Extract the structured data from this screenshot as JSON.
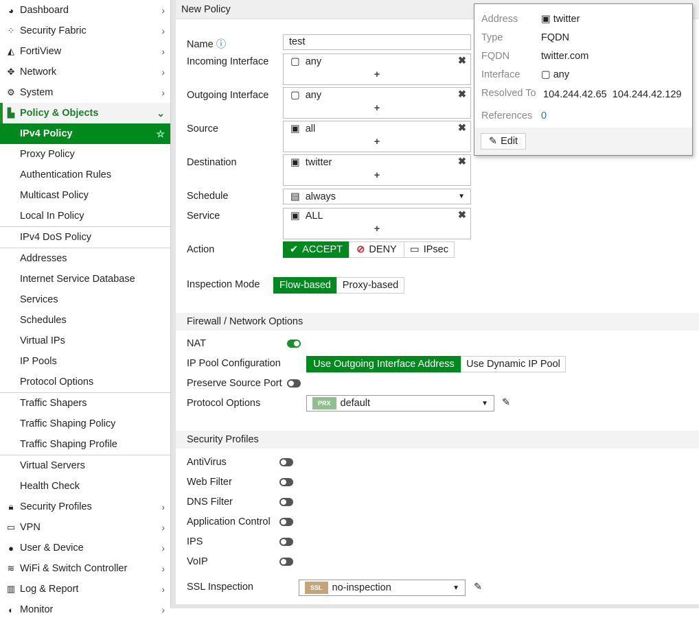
{
  "sidebar": {
    "items": [
      {
        "label": "Dashboard",
        "icon": "dashboard-icon"
      },
      {
        "label": "Security Fabric",
        "icon": "fabric-icon"
      },
      {
        "label": "FortiView",
        "icon": "chart-icon"
      },
      {
        "label": "Network",
        "icon": "move-icon"
      },
      {
        "label": "System",
        "icon": "gear-icon"
      },
      {
        "label": "Policy & Objects",
        "icon": "policy-icon"
      }
    ],
    "policy_sub": [
      "IPv4 Policy",
      "Proxy Policy",
      "Authentication Rules",
      "Multicast Policy",
      "Local In Policy",
      "IPv4 DoS Policy",
      "Addresses",
      "Internet Service Database",
      "Services",
      "Schedules",
      "Virtual IPs",
      "IP Pools",
      "Protocol Options",
      "Traffic Shapers",
      "Traffic Shaping Policy",
      "Traffic Shaping Profile",
      "Virtual Servers",
      "Health Check"
    ],
    "bottom": [
      {
        "label": "Security Profiles"
      },
      {
        "label": "VPN"
      },
      {
        "label": "User & Device"
      },
      {
        "label": "WiFi & Switch Controller"
      },
      {
        "label": "Log & Report"
      },
      {
        "label": "Monitor"
      }
    ]
  },
  "header": {
    "title": "New Policy"
  },
  "form": {
    "name_label": "Name",
    "name_value": "test",
    "incoming_label": "Incoming Interface",
    "incoming_value": "any",
    "outgoing_label": "Outgoing Interface",
    "outgoing_value": "any",
    "source_label": "Source",
    "source_value": "all",
    "destination_label": "Destination",
    "destination_value": "twitter",
    "schedule_label": "Schedule",
    "schedule_value": "always",
    "service_label": "Service",
    "service_value": "ALL",
    "plus": "+",
    "action_label": "Action",
    "actions": [
      "ACCEPT",
      "DENY",
      "IPsec"
    ],
    "inspection_label": "Inspection Mode",
    "inspection_modes": [
      "Flow-based",
      "Proxy-based"
    ]
  },
  "firewall": {
    "title": "Firewall / Network Options",
    "nat_label": "NAT",
    "nat_on": true,
    "ippool_label": "IP Pool Configuration",
    "ippool_options": [
      "Use Outgoing Interface Address",
      "Use Dynamic IP Pool"
    ],
    "preserve_label": "Preserve Source Port",
    "preserve_on": false,
    "protocol_label": "Protocol Options",
    "protocol_badge": "PRX",
    "protocol_value": "default"
  },
  "security": {
    "title": "Security Profiles",
    "profiles": [
      {
        "label": "AntiVirus",
        "on": false
      },
      {
        "label": "Web Filter",
        "on": false
      },
      {
        "label": "DNS Filter",
        "on": false
      },
      {
        "label": "Application Control",
        "on": false
      },
      {
        "label": "IPS",
        "on": false
      },
      {
        "label": "VoIP",
        "on": false
      }
    ],
    "ssl_label": "SSL Inspection",
    "ssl_badge": "SSL",
    "ssl_value": "no-inspection"
  },
  "popup": {
    "address_label": "Address",
    "address_value": "twitter",
    "type_label": "Type",
    "type_value": "FQDN",
    "fqdn_label": "FQDN",
    "fqdn_value": "twitter.com",
    "interface_label": "Interface",
    "interface_value": "any",
    "resolved_label": "Resolved To",
    "resolved_1": "104.244.42.65",
    "resolved_2": "104.244.42.129",
    "references_label": "References",
    "references_value": "0",
    "edit_label": "Edit"
  },
  "colors": {
    "accent": "#008a1e",
    "prx": "#8fbf8f",
    "ssl": "#c4a57a"
  }
}
